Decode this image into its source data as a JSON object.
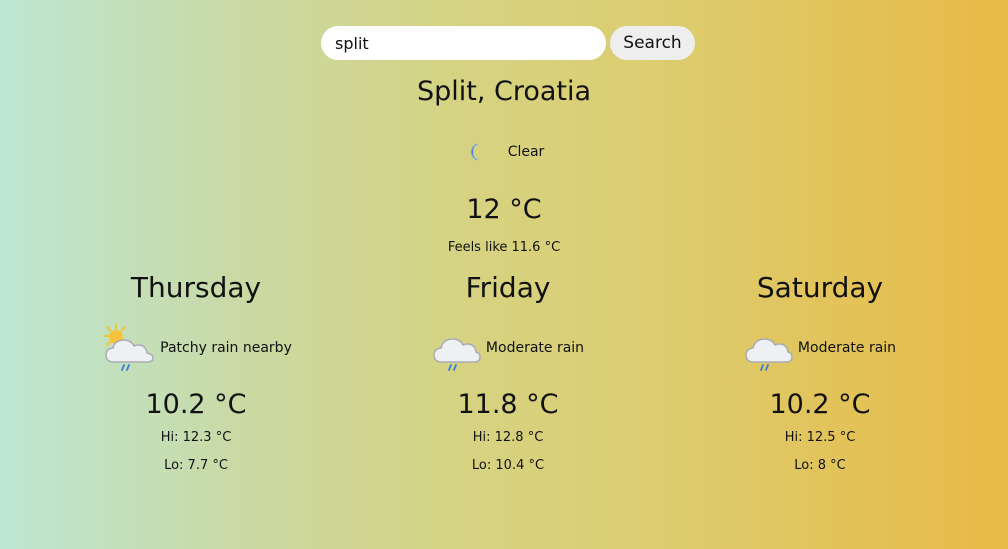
{
  "search": {
    "value": "split",
    "button_label": "Search"
  },
  "location": "Split, Croatia",
  "current": {
    "icon": "moon-icon",
    "condition": "Clear",
    "temp": "12 °C",
    "feels_like": "Feels like 11.6 °C"
  },
  "forecast": [
    {
      "day": "Thursday",
      "icon": "sun-cloud-rain-icon",
      "condition": "Patchy rain nearby",
      "temp": "10.2 °C",
      "hi": "Hi: 12.3 °C",
      "lo": "Lo: 7.7 °C"
    },
    {
      "day": "Friday",
      "icon": "cloud-rain-icon",
      "condition": "Moderate rain",
      "temp": "11.8 °C",
      "hi": "Hi: 12.8 °C",
      "lo": "Lo: 10.4 °C"
    },
    {
      "day": "Saturday",
      "icon": "cloud-rain-icon",
      "condition": "Moderate rain",
      "temp": "10.2 °C",
      "hi": "Hi: 12.5 °C",
      "lo": "Lo: 8 °C"
    }
  ]
}
